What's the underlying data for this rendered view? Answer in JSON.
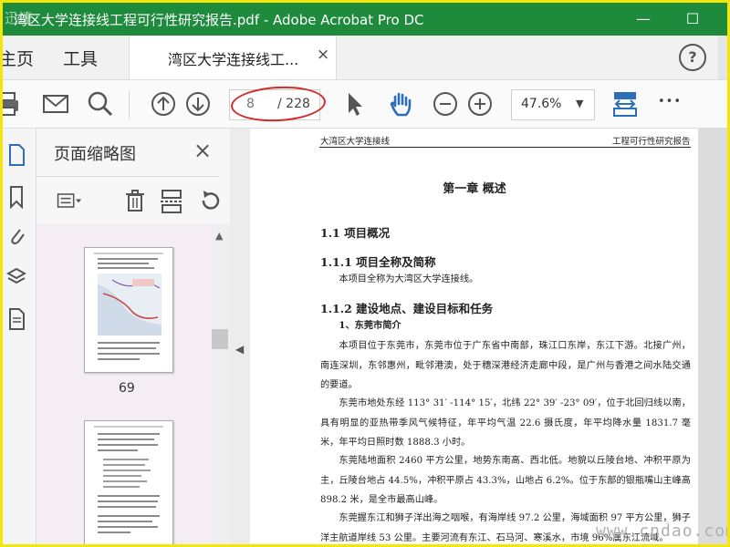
{
  "window": {
    "title": "湾区大学连接线工程可行性研究报告.pdf - Adobe Acrobat Pro DC",
    "watermark_overlay": "迅捷",
    "minimize_label": "—",
    "maximize_label": "☐"
  },
  "tabs": {
    "home": "主页",
    "tools": "工具",
    "document": "湾区大学连接线工...",
    "close": "×",
    "help": "?"
  },
  "toolbar": {
    "current_page": "8",
    "total_pages": "/ 228",
    "zoom": "47.6%",
    "zoom_arrow": "▼",
    "more": "•••"
  },
  "thumbnail_panel": {
    "title": "页面缩略图",
    "close": "×",
    "page_number": "69"
  },
  "document": {
    "header_left": "大湾区大学连接线",
    "header_right": "工程可行性研究报告",
    "chapter": "第一章  概述",
    "s1_1": "1.1  项目概况",
    "s1_1_1": "1.1.1  项目全称及简称",
    "p1": "本项目全称为大湾区大学连接线。",
    "s1_1_2": "1.1.2  建设地点、建设目标和任务",
    "item1": "1、东莞市简介",
    "p2": "本项目位于东莞市，东莞市位于广东省中南部，珠江口东岸，东江下游。北接广州，南连深圳，东邻惠州，毗邻港澳，处于穗深港经济走廊中段，是广州与香港之间水陆交通的要道。",
    "p3": "东莞市地处东经 113° 31′ -114° 15′，北纬 22° 39′ -23° 09′，位于北回归线以南，具有明显的亚热带季风气候特征，年平均气温 22.6 摄氏度，年平均降水量 1831.7 毫米，年平均日照时数 1888.3 小时。",
    "p4": "东莞陆地面积 2460 平方公里，地势东南高、西北低。地貌以丘陵台地、冲积平原为主，丘陵台地占 44.5%，冲积平原占 43.3%，山地占 6.2%。位于东部的银瓶嘴山主峰高 898.2 米，是全市最高山峰。",
    "p5": "东莞握东江和狮子洋出海之咽喉，有海岸线 97.2 公里，海域面积 97 平方公里，狮子洋主航道岸线 53 公里。主要河流有东江、石马河、寒溪水，市境 96%属东江流域。"
  },
  "site_watermark": "www.cndao.com",
  "colors": {
    "titlebar": "#1e8a3c",
    "icon_blue": "#2c6fb8",
    "annotation_red": "#d42a2a"
  }
}
